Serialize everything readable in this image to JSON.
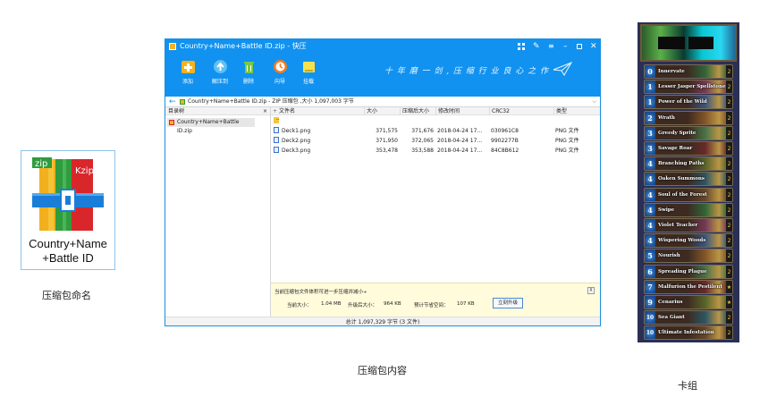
{
  "left": {
    "zip_badge": "zip",
    "kzip_badge": "Kzip",
    "archive_name_line1": "Country+Name",
    "archive_name_line2": "+Battle ID",
    "caption": "压缩包命名"
  },
  "window": {
    "title": "Country+Name+Battle ID.zip - 快压",
    "toolbar": {
      "add": "添加",
      "extract": "解压到",
      "delete": "删除",
      "wizard": "向导",
      "mount": "挂载"
    },
    "slogan": "十 年 磨 一 剑 ,  压 缩 行 业 良 心 之 作",
    "path": "Country+Name+Battle ID.zip - ZIP 压缩包 ,大小 1,097,003 字节",
    "tree_header": "目录树",
    "tree_close": "×",
    "tree_item": "Country+Name+Battle ID.zip",
    "columns": {
      "name": "文件名",
      "size": "大小",
      "packed": "压缩后大小",
      "modified": "修改时间",
      "crc": "CRC32",
      "type": "类型"
    },
    "up_dir": "..",
    "files": [
      {
        "name": "Deck1.png",
        "size": "371,575",
        "packed": "371,676",
        "modified": "2018-04-24  17...",
        "crc": "030961C8",
        "type": "PNG 文件"
      },
      {
        "name": "Deck2.png",
        "size": "371,950",
        "packed": "372,065",
        "modified": "2018-04-24  17...",
        "crc": "9902277B",
        "type": "PNG 文件"
      },
      {
        "name": "Deck3.png",
        "size": "353,478",
        "packed": "353,588",
        "modified": "2018-04-24  17...",
        "crc": "84C8B612",
        "type": "PNG 文件"
      }
    ],
    "tip": {
      "message": "当前压缩包文件体积可进一步压缩并减小÷",
      "current_label": "当前大小：",
      "current_value": "1.04 MB",
      "after_label": "升级后大小：",
      "after_value": "964 KB",
      "save_label": "预计节省空间：",
      "save_value": "107 KB",
      "upgrade_button": "立刻升级",
      "close": "X"
    },
    "status": "总计  1,097,329 字节 (3 文件)",
    "caption": "压缩包内容"
  },
  "deck": {
    "caption": "卡组",
    "cards": [
      {
        "cost": "0",
        "name": "Innervate",
        "count": "2"
      },
      {
        "cost": "1",
        "name": "Lesser Jasper Spellstone",
        "count": "2"
      },
      {
        "cost": "1",
        "name": "Power of the Wild",
        "count": "2"
      },
      {
        "cost": "2",
        "name": "Wrath",
        "count": "2"
      },
      {
        "cost": "3",
        "name": "Greedy Sprite",
        "count": "2"
      },
      {
        "cost": "3",
        "name": "Savage Roar",
        "count": "2"
      },
      {
        "cost": "4",
        "name": "Branching Paths",
        "count": "2"
      },
      {
        "cost": "4",
        "name": "Oaken Summons",
        "count": "2"
      },
      {
        "cost": "4",
        "name": "Soul of the Forest",
        "count": "2"
      },
      {
        "cost": "4",
        "name": "Swipe",
        "count": "2"
      },
      {
        "cost": "4",
        "name": "Violet Teacher",
        "count": "2"
      },
      {
        "cost": "4",
        "name": "Wispering Woods",
        "count": "2"
      },
      {
        "cost": "5",
        "name": "Nourish",
        "count": "2"
      },
      {
        "cost": "6",
        "name": "Spreading Plague",
        "count": "2"
      },
      {
        "cost": "7",
        "name": "Malfurion the Pestilent",
        "count": "★"
      },
      {
        "cost": "9",
        "name": "Cenarius",
        "count": "★"
      },
      {
        "cost": "10",
        "name": "Sea Giant",
        "count": "2"
      },
      {
        "cost": "10",
        "name": "Ultimate Infestation",
        "count": "2"
      }
    ]
  },
  "colors": {
    "accent_blue": "#1192f0",
    "tip_bg": "#fffbdb",
    "deck_bg": "#2a2f55"
  }
}
